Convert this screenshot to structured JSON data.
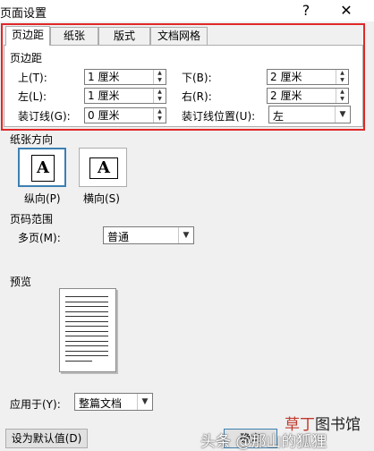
{
  "window": {
    "title": "页面设置",
    "help_glyph": "?",
    "close_glyph": "✕"
  },
  "tabs": [
    {
      "label": "页边距"
    },
    {
      "label": "纸张"
    },
    {
      "label": "版式"
    },
    {
      "label": "文档网格"
    }
  ],
  "margins": {
    "section_title": "页边距",
    "top": {
      "label": "上(T):",
      "value": "1 厘米"
    },
    "bottom": {
      "label": "下(B):",
      "value": "2 厘米"
    },
    "left": {
      "label": "左(L):",
      "value": "1 厘米"
    },
    "right": {
      "label": "右(R):",
      "value": "2 厘米"
    },
    "gutter": {
      "label": "装订线(G):",
      "value": "0 厘米"
    },
    "gutter_position": {
      "label": "装订线位置(U):",
      "value": "左"
    }
  },
  "orientation": {
    "section_title": "纸张方向",
    "portrait": {
      "label": "纵向(P)",
      "glyph": "A",
      "selected": true
    },
    "landscape": {
      "label": "横向(S)",
      "glyph": "A",
      "selected": false
    }
  },
  "pages": {
    "section_title": "页码范围",
    "multiple_label": "多页(M):",
    "multiple_value": "普通"
  },
  "preview": {
    "section_title": "预览",
    "line_count": 14
  },
  "apply_to": {
    "label": "应用于(Y):",
    "value": "整篇文档"
  },
  "buttons": {
    "set_default": "设为默认值(D)",
    "ok_partial": "确定"
  },
  "watermark": {
    "logo_text": "草丁图书馆",
    "caption": "头条 @那山的狐狸"
  },
  "colors": {
    "highlight_frame": "#e02828",
    "selected_border": "#3c7fb1",
    "logo_accent": "#c0392b"
  }
}
